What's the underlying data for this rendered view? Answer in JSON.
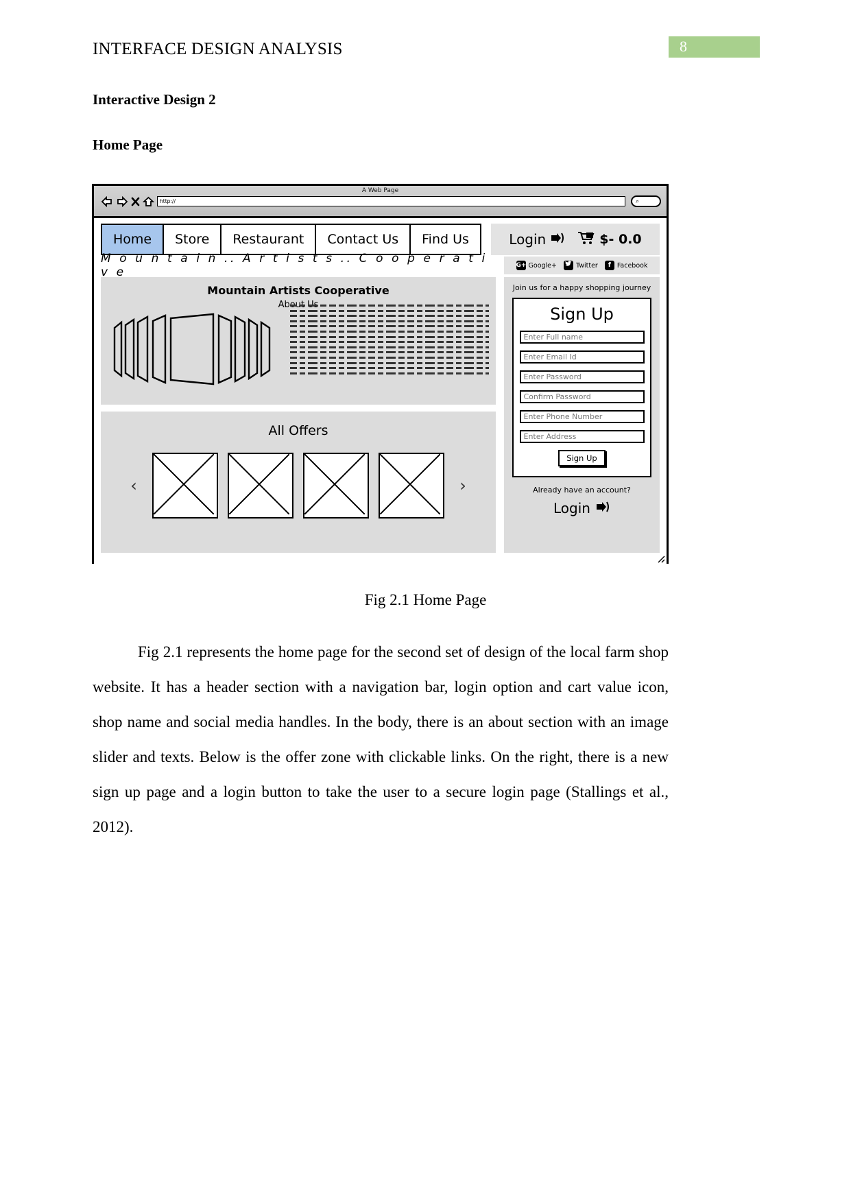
{
  "document": {
    "running_header": "INTERFACE DESIGN ANALYSIS",
    "page_number": "8",
    "page_number_bg": "#a8d08d",
    "heading_1": "Interactive Design 2",
    "heading_2": "Home Page",
    "figure_caption": "Fig 2.1 Home Page",
    "body_paragraph": "Fig 2.1 represents the home page for the second set of design of the local farm shop website. It has a header section with a navigation bar, login option and cart value icon, shop name and social media handles. In the body, there is an about section with an image slider and texts. Below is the offer zone with clickable links. On the right, there is a new sign up page and a login button to take the user to a secure login page (Stallings et al., 2012)."
  },
  "wireframe": {
    "browser": {
      "window_title": "A Web Page",
      "url_value": "http://",
      "back_icon": "back-arrow-icon",
      "forward_icon": "forward-arrow-icon",
      "stop_icon": "close-x-icon",
      "home_icon": "home-icon",
      "search_icon": "magnifier-icon"
    },
    "nav": {
      "tabs": [
        {
          "label": "Home",
          "active": true
        },
        {
          "label": "Store",
          "active": false
        },
        {
          "label": "Restaurant",
          "active": false
        },
        {
          "label": "Contact Us",
          "active": false
        },
        {
          "label": "Find Us",
          "active": false
        }
      ],
      "active_tab_color": "#a7c6ed"
    },
    "account_bar": {
      "login_label": "Login",
      "login_icon": "login-arrow-icon",
      "cart_icon": "shopping-cart-icon",
      "cart_value": "$- 0.0"
    },
    "brand": {
      "name": "M o u n t a i n .. A r t i s t s .. C o o p e r a t i v e"
    },
    "social": [
      {
        "label": "Google+",
        "badge": "G+",
        "icon": "google-plus-icon"
      },
      {
        "label": "Twitter",
        "badge": "t",
        "icon": "twitter-icon"
      },
      {
        "label": "Facebook",
        "badge": "f",
        "icon": "facebook-icon"
      }
    ],
    "about": {
      "title": "Mountain Artists Cooperative",
      "subtitle": "About Us",
      "slider_icon": "image-slider-placeholder",
      "body_placeholder_lines": 14
    },
    "offers": {
      "title": "All Offers",
      "prev_arrow": "‹",
      "next_arrow": "›",
      "thumbnails": [
        "offer-image-placeholder-1",
        "offer-image-placeholder-2",
        "offer-image-placeholder-3",
        "offer-image-placeholder-4"
      ]
    },
    "signup": {
      "tagline": "Join us for a happy shopping journey",
      "heading": "Sign Up",
      "fields": [
        {
          "placeholder": "Enter Full name"
        },
        {
          "placeholder": "Enter Email Id"
        },
        {
          "placeholder": "Enter Password"
        },
        {
          "placeholder": "Confirm Password"
        },
        {
          "placeholder": "Enter Phone Number"
        },
        {
          "placeholder": "Enter Address"
        }
      ],
      "submit_label": "Sign Up",
      "have_account_text": "Already have an account?",
      "login_label": "Login",
      "login_icon": "login-arrow-icon"
    }
  }
}
